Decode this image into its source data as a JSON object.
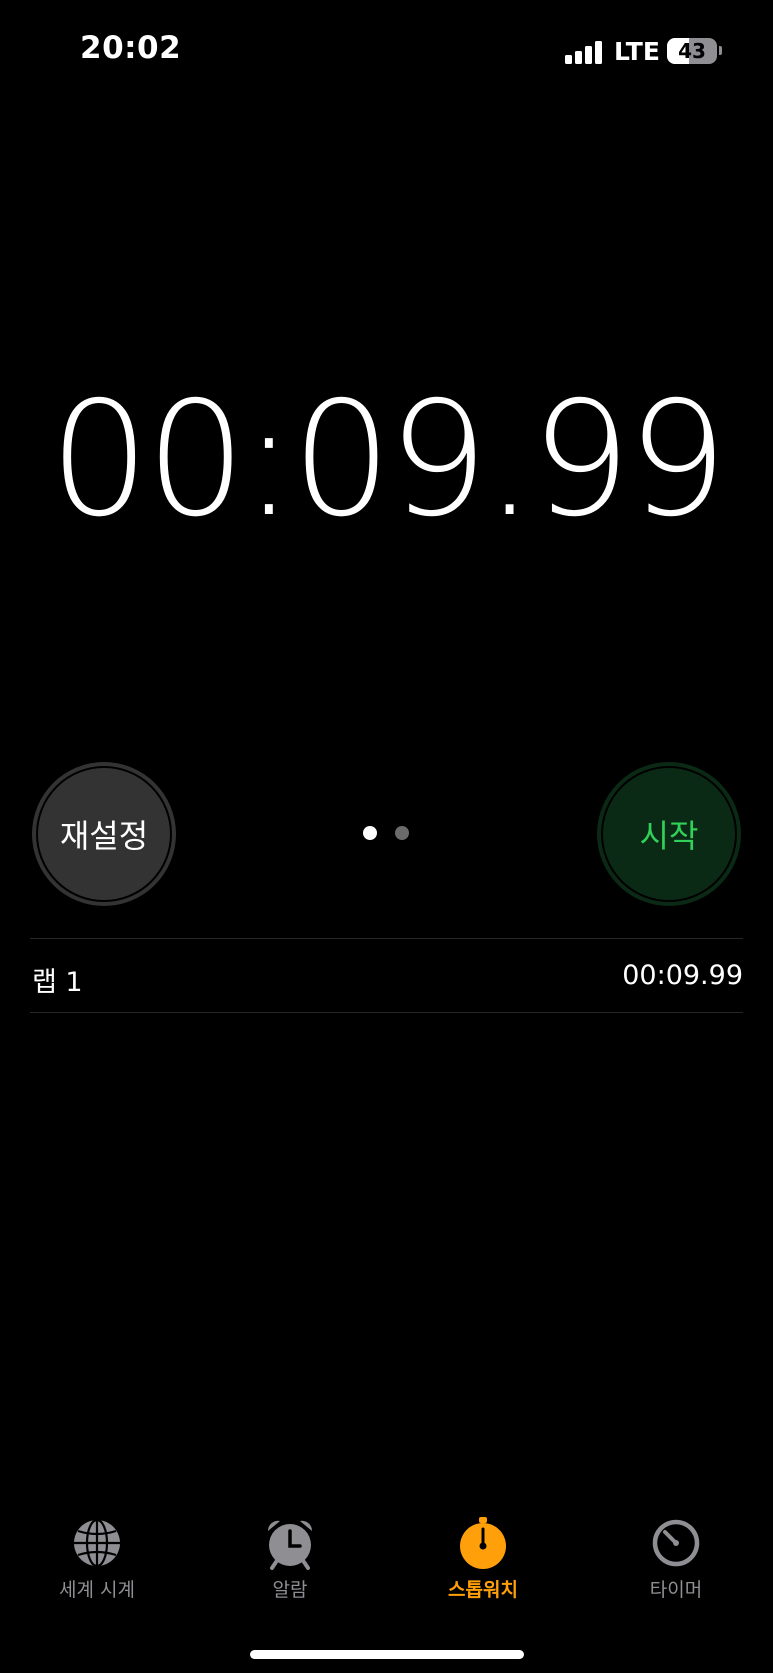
{
  "status_bar": {
    "time": "20:02",
    "network": "LTE",
    "battery_level": "43",
    "battery_fraction": 0.43,
    "signal_bars": 4
  },
  "stopwatch": {
    "display": "00:09.99"
  },
  "controls": {
    "reset_label": "재설정",
    "start_label": "시작",
    "page_count": 2,
    "current_page": 1
  },
  "laps": [
    {
      "label": "랩 1",
      "time": "00:09.99"
    }
  ],
  "tabs": [
    {
      "label": "세계 시계",
      "icon": "globe-icon",
      "selected": false
    },
    {
      "label": "알람",
      "icon": "alarm-clock-icon",
      "selected": false
    },
    {
      "label": "스톱워치",
      "icon": "stopwatch-icon",
      "selected": true
    },
    {
      "label": "타이머",
      "icon": "timer-icon",
      "selected": false
    }
  ],
  "colors": {
    "background": "#000000",
    "accent": "#ff9f0a",
    "start_text": "#31d159",
    "start_bg": "#0b2a15",
    "reset_bg": "#333333",
    "inactive_tab": "#8e8e93"
  }
}
